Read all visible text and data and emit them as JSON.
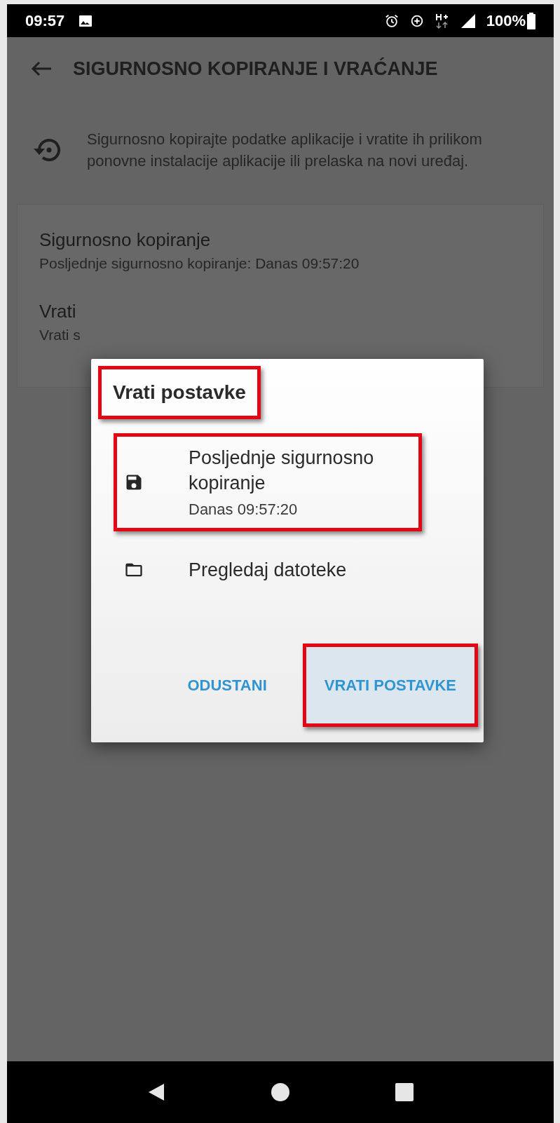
{
  "status_bar": {
    "time": "09:57",
    "battery": "100%"
  },
  "app_bar": {
    "title": "SIGURNOSNO KOPIRANJE I VRAĆANJE"
  },
  "description": "Sigurnosno kopirajte podatke aplikacije i vratite ih prilikom ponovne instalacije aplikacije ili prelaska na novi uređaj.",
  "settings": [
    {
      "title": "Sigurnosno kopiranje",
      "subtitle": "Posljednje sigurnosno kopiranje: Danas 09:57:20"
    },
    {
      "title": "Vrati",
      "subtitle": "Vrati s"
    }
  ],
  "dialog": {
    "title": "Vrati postavke",
    "title_highlighted": true,
    "options": [
      {
        "kind": "save",
        "label": "Posljednje sigurnosno kopiranje",
        "detail": "Danas 09:57:20",
        "highlighted": true
      },
      {
        "kind": "folder",
        "label": "Pregledaj datoteke",
        "highlighted": false
      }
    ],
    "buttons": [
      {
        "label": "ODUSTANI",
        "highlighted": false,
        "pressed": false
      },
      {
        "label": "VRATI POSTAVKE",
        "highlighted": true,
        "pressed": true
      }
    ]
  }
}
